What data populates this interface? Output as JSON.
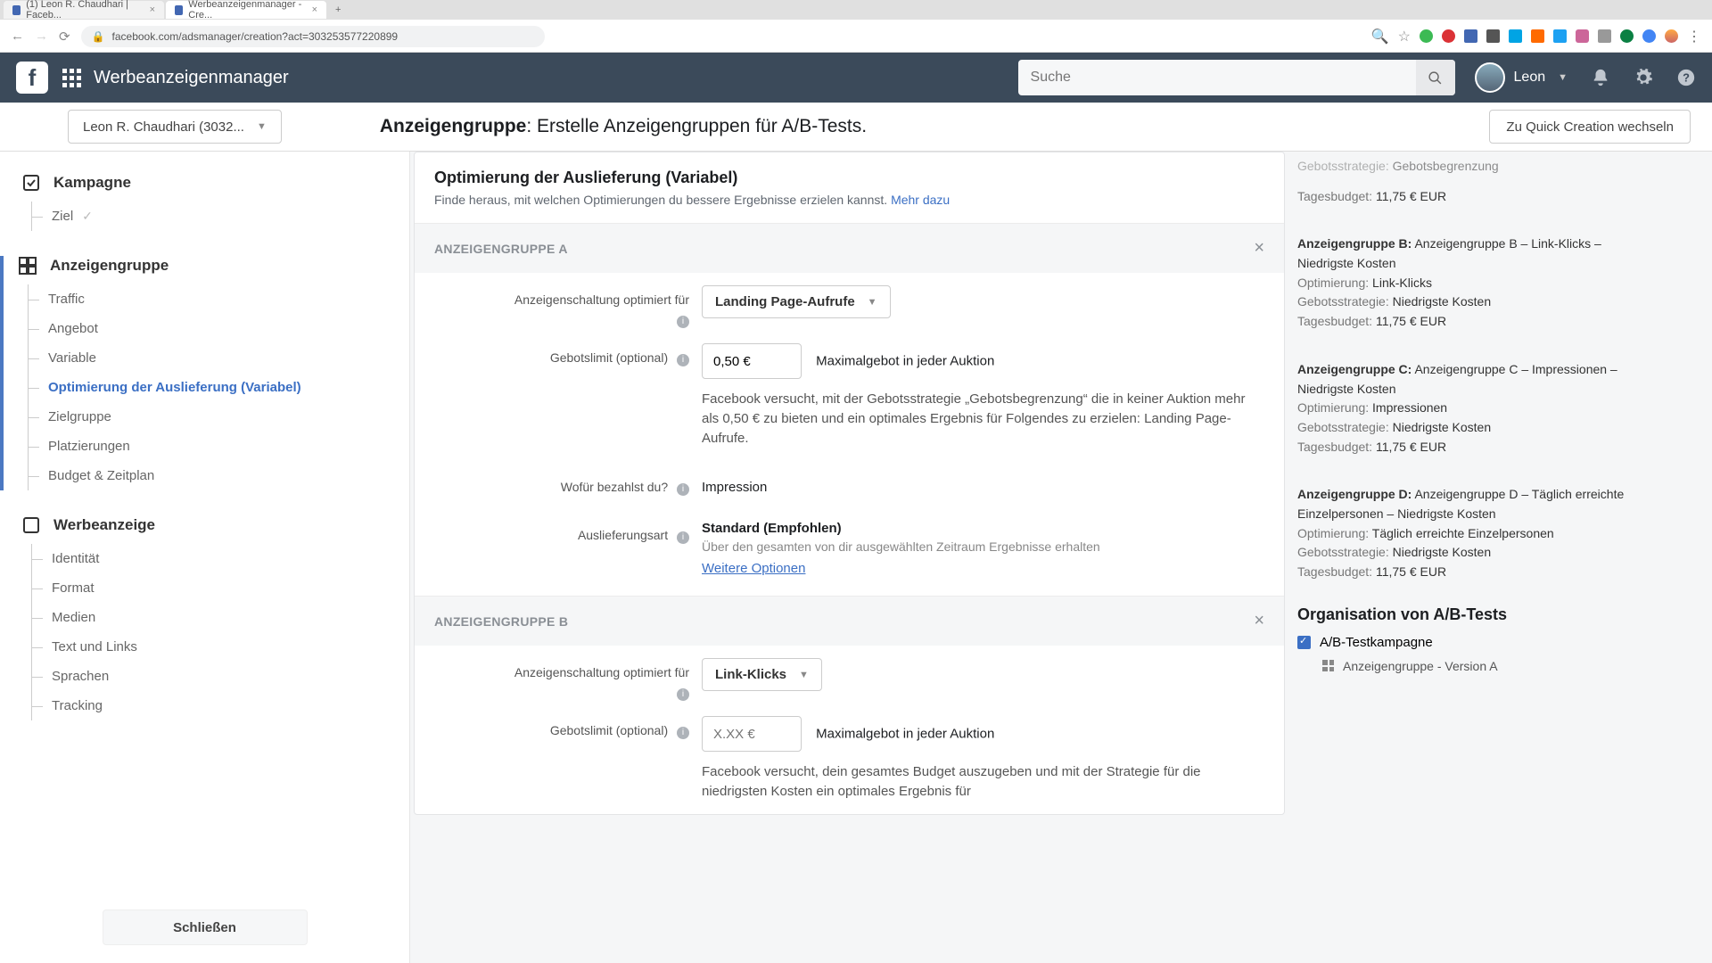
{
  "browser": {
    "tabs": [
      {
        "label": "(1) Leon R. Chaudhari | Faceb..."
      },
      {
        "label": "Werbeanzeigenmanager - Cre..."
      }
    ],
    "url": "facebook.com/adsmanager/creation?act=303253577220899"
  },
  "header": {
    "app_title": "Werbeanzeigenmanager",
    "search_placeholder": "Suche",
    "user_name": "Leon"
  },
  "page": {
    "account": "Leon R. Chaudhari (3032...",
    "title_bold": "Anzeigengruppe",
    "title_rest": ": Erstelle Anzeigengruppen für A/B-Tests.",
    "quick_btn": "Zu Quick Creation wechseln"
  },
  "sidebar": {
    "campaign": {
      "head": "Kampagne",
      "items": [
        "Ziel"
      ]
    },
    "adset": {
      "head": "Anzeigengruppe",
      "items": [
        "Traffic",
        "Angebot",
        "Variable",
        "Optimierung der Auslieferung (Variabel)",
        "Zielgruppe",
        "Platzierungen",
        "Budget & Zeitplan"
      ]
    },
    "ad": {
      "head": "Werbeanzeige",
      "items": [
        "Identität",
        "Format",
        "Medien",
        "Text und Links",
        "Sprachen",
        "Tracking"
      ]
    },
    "close": "Schließen"
  },
  "content": {
    "card_title": "Optimierung der Auslieferung (Variabel)",
    "card_sub": "Finde heraus, mit welchen Optimierungen du bessere Ergebnisse erzielen kannst.",
    "learn_more": "Mehr dazu",
    "groupA": {
      "label": "ANZEIGENGRUPPE A",
      "opt_label": "Anzeigenschaltung optimiert für",
      "opt_value": "Landing Page-Aufrufe",
      "bid_label": "Gebotslimit (optional)",
      "bid_value": "0,50 €",
      "bid_side": "Maximalgebot in jeder Auktion",
      "bid_help": "Facebook versucht, mit der Gebotsstrategie „Gebotsbegrenzung“ die in keiner Auktion mehr als 0,50 € zu bieten und ein optimales Ergebnis für Folgendes zu erzielen: Landing Page-Aufrufe.",
      "pay_label": "Wofür bezahlst du?",
      "pay_value": "Impression",
      "deliv_label": "Auslieferungsart",
      "deliv_value": "Standard (Empfohlen)",
      "deliv_sub": "Über den gesamten von dir ausgewählten Zeitraum Ergebnisse erhalten",
      "deliv_link": "Weitere Optionen"
    },
    "groupB": {
      "label": "ANZEIGENGRUPPE B",
      "opt_label": "Anzeigenschaltung optimiert für",
      "opt_value": "Link-Klicks",
      "bid_label": "Gebotslimit (optional)",
      "bid_placeholder": "X.XX €",
      "bid_side": "Maximalgebot in jeder Auktion",
      "bid_help": "Facebook versucht, dein gesamtes Budget auszugeben und mit der Strategie für die niedrigsten Kosten ein optimales Ergebnis für"
    }
  },
  "right": {
    "top_strategy_lbl": "Gebotsstrategie:",
    "top_strategy_val": "Gebotsbegrenzung",
    "budget_lbl": "Tagesbudget:",
    "budget_val": "11,75 € EUR",
    "groups": [
      {
        "title_lbl": "Anzeigengruppe B:",
        "title_val": "Anzeigengruppe B – Link-Klicks – Niedrigste Kosten",
        "opt_lbl": "Optimierung:",
        "opt_val": "Link-Klicks",
        "bid_lbl": "Gebotsstrategie:",
        "bid_val": "Niedrigste Kosten"
      },
      {
        "title_lbl": "Anzeigengruppe C:",
        "title_val": "Anzeigengruppe C – Impressionen – Niedrigste Kosten",
        "opt_lbl": "Optimierung:",
        "opt_val": "Impressionen",
        "bid_lbl": "Gebotsstrategie:",
        "bid_val": "Niedrigste Kosten"
      },
      {
        "title_lbl": "Anzeigengruppe D:",
        "title_val": "Anzeigengruppe D – Täglich erreichte Einzelpersonen – Niedrigste Kosten",
        "opt_lbl": "Optimierung:",
        "opt_val": "Täglich erreichte Einzelpersonen",
        "bid_lbl": "Gebotsstrategie:",
        "bid_val": "Niedrigste Kosten"
      }
    ],
    "org_head": "Organisation von A/B-Tests",
    "org_campaign": "A/B-Testkampagne",
    "org_item": "Anzeigengruppe - Version A"
  }
}
